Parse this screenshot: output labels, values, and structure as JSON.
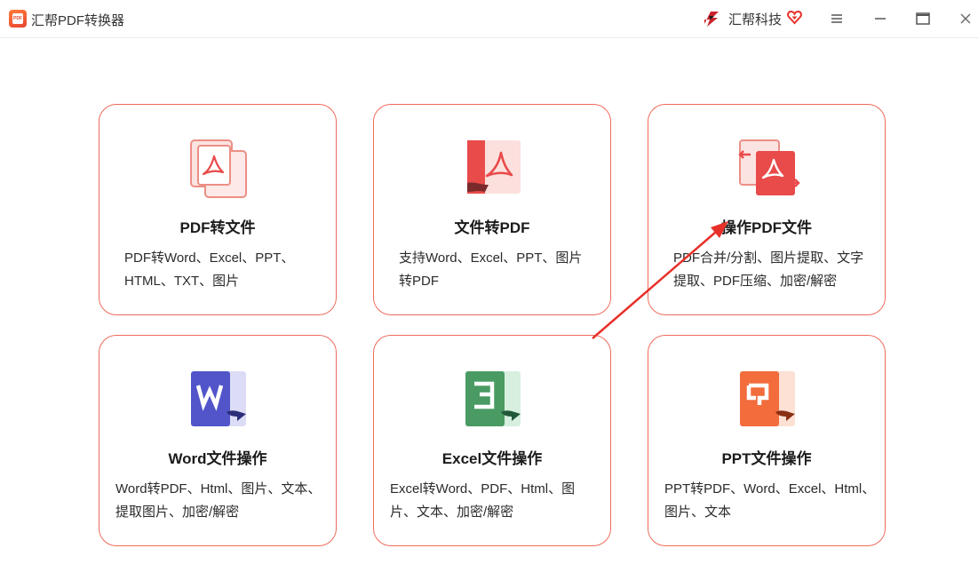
{
  "app": {
    "title": "汇帮PDF转换器",
    "logo_text": "PDF",
    "brand": "汇帮科技"
  },
  "colors": {
    "card_border": "#ee6b5b",
    "pdf_red": "#e94a4a",
    "word_blue": "#5255c9",
    "excel_green": "#4a9b63",
    "ppt_orange": "#f26c3c",
    "annotation_arrow": "#e8302a"
  },
  "icons": {
    "menu": "hamburger-menu-icon",
    "minimize": "minimize-icon",
    "maximize": "maximize-icon",
    "close": "close-icon"
  },
  "cards": [
    {
      "title": "PDF转文件",
      "desc": "PDF转Word、Excel、PPT、HTML、TXT、图片",
      "icon": "pdf-to-file-icon"
    },
    {
      "title": "文件转PDF",
      "desc": "支持Word、Excel、PPT、图片转PDF",
      "icon": "file-to-pdf-icon"
    },
    {
      "title": "操作PDF文件",
      "desc": "PDF合并/分割、图片提取、文字提取、PDF压缩、加密/解密",
      "icon": "pdf-operations-icon"
    },
    {
      "title": "Word文件操作",
      "desc": "Word转PDF、Html、图片、文本、提取图片、加密/解密",
      "icon": "word-file-icon"
    },
    {
      "title": "Excel文件操作",
      "desc": "Excel转Word、PDF、Html、图片、文本、加密/解密",
      "icon": "excel-file-icon"
    },
    {
      "title": "PPT文件操作",
      "desc": "PPT转PDF、Word、Excel、Html、图片、文本",
      "icon": "ppt-file-icon"
    }
  ]
}
